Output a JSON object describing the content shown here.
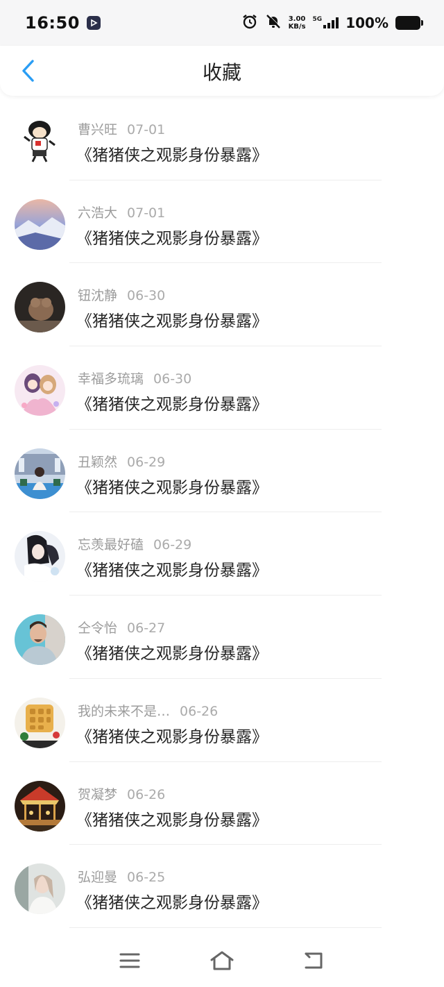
{
  "status_bar": {
    "time": "16:50",
    "speed_value": "3.00",
    "speed_unit": "KB/s",
    "network": "5G",
    "battery": "100%"
  },
  "header": {
    "title": "收藏",
    "accent_color": "#2a9df4"
  },
  "favorites": [
    {
      "name": "曹兴旺",
      "date": "07-01",
      "subject": "《猪猪侠之观影身份暴露》"
    },
    {
      "name": "六浩大",
      "date": "07-01",
      "subject": "《猪猪侠之观影身份暴露》"
    },
    {
      "name": "钮沈静",
      "date": "06-30",
      "subject": "《猪猪侠之观影身份暴露》"
    },
    {
      "name": "幸福多琉璃",
      "date": "06-30",
      "subject": "《猪猪侠之观影身份暴露》"
    },
    {
      "name": "丑颖然",
      "date": "06-29",
      "subject": "《猪猪侠之观影身份暴露》"
    },
    {
      "name": "忘羡最好磕",
      "date": "06-29",
      "subject": "《猪猪侠之观影身份暴露》"
    },
    {
      "name": "仝令怡",
      "date": "06-27",
      "subject": "《猪猪侠之观影身份暴露》"
    },
    {
      "name": "我的未来不是…",
      "date": "06-26",
      "subject": "《猪猪侠之观影身份暴露》"
    },
    {
      "name": "贺凝梦",
      "date": "06-26",
      "subject": "《猪猪侠之观影身份暴露》"
    },
    {
      "name": "弘迎曼",
      "date": "06-25",
      "subject": "《猪猪侠之观影身份暴露》"
    }
  ],
  "icons": {
    "back": "chevron-left-icon",
    "menu": "menu-icon",
    "home": "home-icon",
    "back_nav": "return-icon"
  }
}
